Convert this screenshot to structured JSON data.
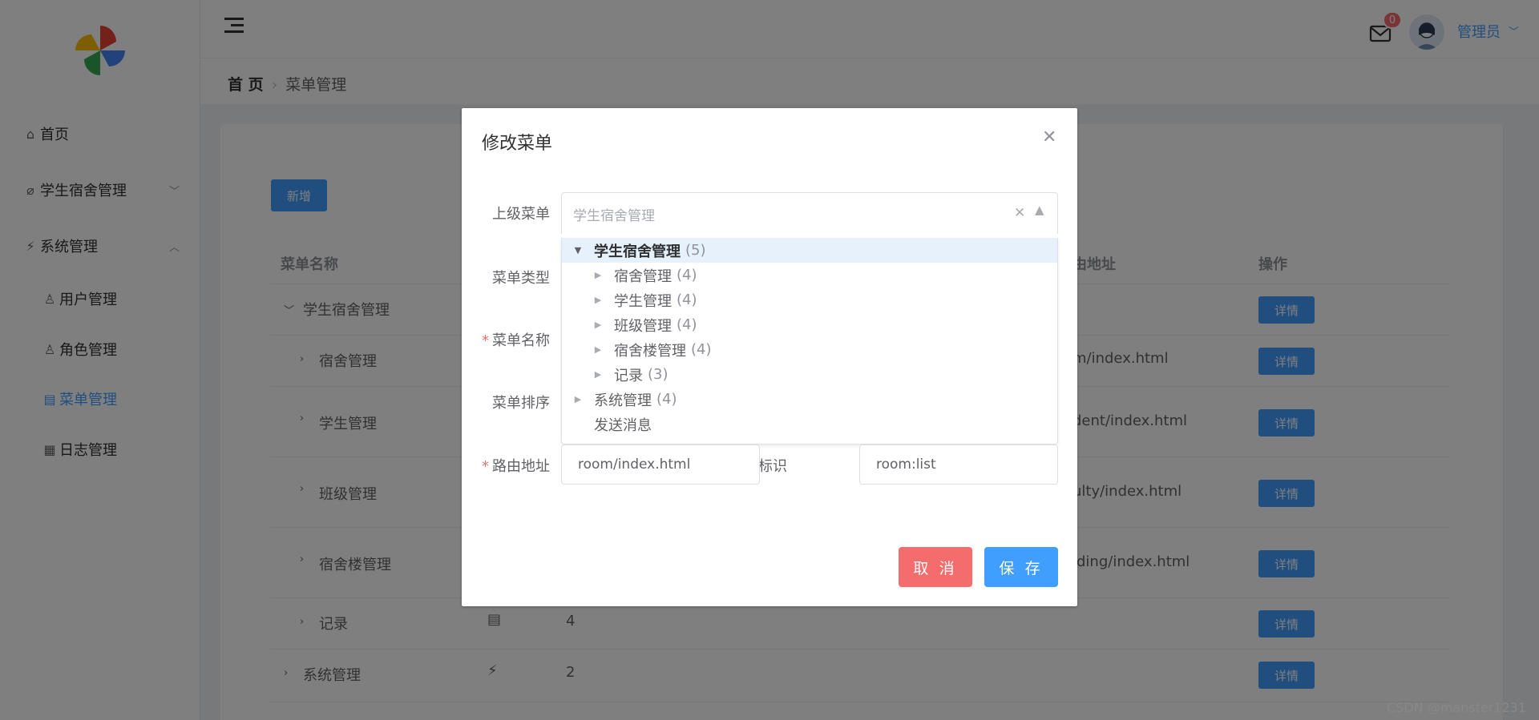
{
  "sidebar": {
    "items": [
      {
        "label": "首页",
        "icon": "home-icon"
      },
      {
        "label": "学生宿舍管理",
        "icon": "paperclip-icon"
      },
      {
        "label": "系统管理",
        "icon": "lightning-icon"
      },
      {
        "label": "用户管理",
        "icon": "user-icon"
      },
      {
        "label": "角色管理",
        "icon": "user-group-icon"
      },
      {
        "label": "菜单管理",
        "icon": "document-icon"
      },
      {
        "label": "日志管理",
        "icon": "table-icon"
      }
    ]
  },
  "header": {
    "badge_count": "0",
    "user_name": "管理员"
  },
  "breadcrumb": {
    "home": "首 页",
    "current": "菜单管理"
  },
  "toolbar": {
    "add_label": "新增"
  },
  "table": {
    "headers": {
      "name": "菜单名称",
      "path": "由地址",
      "actions": "操作"
    },
    "rows": [
      {
        "name": "学生宿舍管理",
        "path": "",
        "sort": "",
        "detail": "详情"
      },
      {
        "name": "宿舍管理",
        "path": "m/index.html",
        "sort": "",
        "detail": "详情"
      },
      {
        "name": "学生管理",
        "path": "dent/index.html",
        "sort": "",
        "detail": "详情"
      },
      {
        "name": "班级管理",
        "path": "ulty/index.html",
        "sort": "",
        "detail": "详情"
      },
      {
        "name": "宿舍楼管理",
        "path": "lding/index.html",
        "sort": "",
        "detail": "详情"
      },
      {
        "name": "记录",
        "path": "",
        "sort": "4",
        "detail": "详情"
      },
      {
        "name": "系统管理",
        "path": "",
        "sort": "2",
        "detail": "详情"
      }
    ]
  },
  "dialog": {
    "title": "修改菜单",
    "labels": {
      "parent": "上级菜单",
      "type": "菜单类型",
      "name": "菜单名称",
      "sort": "菜单排序",
      "route": "路由地址",
      "perm": "权限标识"
    },
    "required_mark": "*",
    "parent_placeholder": "学生宿舍管理",
    "route_value": "room/index.html",
    "perm_value": "room:list",
    "cancel_label": "取 消",
    "save_label": "保 存",
    "tree": [
      {
        "label": "学生宿舍管理",
        "count": "(5)",
        "expanded": true
      },
      {
        "label": "宿舍管理",
        "count": "(4)"
      },
      {
        "label": "学生管理",
        "count": "(4)"
      },
      {
        "label": "班级管理",
        "count": "(4)"
      },
      {
        "label": "宿舍楼管理",
        "count": "(4)"
      },
      {
        "label": "记录",
        "count": "(3)"
      },
      {
        "label": "系统管理",
        "count": "(4)"
      },
      {
        "label": "发送消息",
        "count": ""
      }
    ]
  },
  "watermark": "CSDN @manster1231",
  "colors": {
    "primary": "#409eff",
    "danger": "#f56c6c",
    "highlight": "#e6f1fc"
  }
}
